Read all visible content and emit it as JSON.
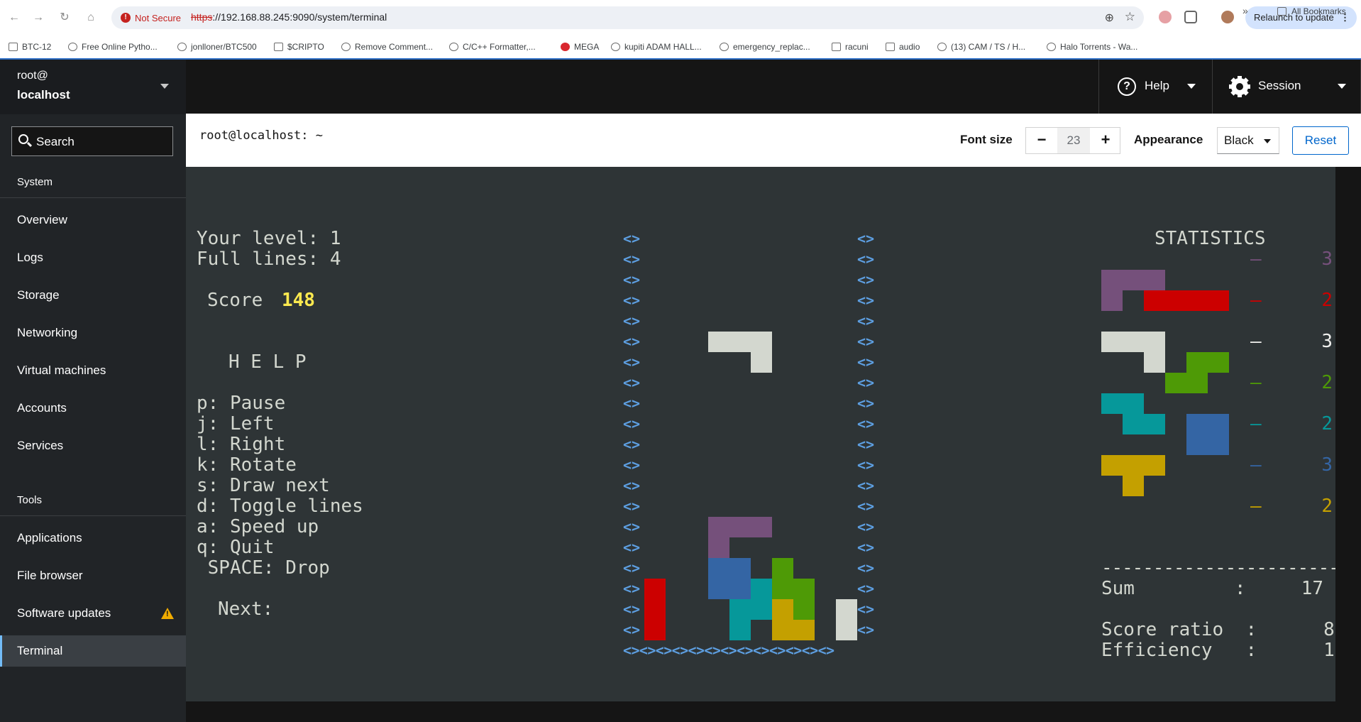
{
  "browser": {
    "security_label": "Not Secure",
    "url_proto": "https",
    "url_rest": "://192.168.88.245:9090/system/terminal",
    "relaunch_label": "Relaunch to update",
    "bookmarks": [
      {
        "label": "BTC-12",
        "icon": "folder-icon"
      },
      {
        "label": "Free Online Pytho...",
        "icon": "site-icon"
      },
      {
        "label": "jonlloner/BTC500",
        "icon": "github-icon"
      },
      {
        "label": "$CRIPTO",
        "icon": "folder-icon"
      },
      {
        "label": "Remove Comment...",
        "icon": "site-icon"
      },
      {
        "label": "C/C++ Formatter,...",
        "icon": "site-icon"
      },
      {
        "label": "MEGA",
        "icon": "mega-icon"
      },
      {
        "label": "kupiti ADAM HALL...",
        "icon": "site-icon"
      },
      {
        "label": "emergency_replac...",
        "icon": "github-icon"
      },
      {
        "label": "racuni",
        "icon": "folder-icon"
      },
      {
        "label": "audio",
        "icon": "folder-icon"
      },
      {
        "label": "(13) CAM / TS / H...",
        "icon": "site-icon"
      },
      {
        "label": "Halo Torrents - Wa...",
        "icon": "site-icon"
      }
    ],
    "all_bookmarks_label": "All Bookmarks",
    "more_label": "»"
  },
  "sidebar": {
    "host_user": "root@",
    "host_name": "localhost",
    "search_label": "Search",
    "system_title": "System",
    "system_items": [
      "Overview",
      "Logs",
      "Storage",
      "Networking",
      "Virtual machines",
      "Accounts",
      "Services"
    ],
    "tools_title": "Tools",
    "tools_items": [
      "Applications",
      "File browser",
      "Software updates",
      "Terminal"
    ],
    "active_item": "Terminal",
    "updates_warning": true
  },
  "masthead": {
    "help_label": "Help",
    "session_label": "Session"
  },
  "toolbar": {
    "title": "root@localhost: ~",
    "font_size_label": "Font size",
    "font_size_value": "23",
    "minus_label": "−",
    "plus_label": "+",
    "appearance_label": "Appearance",
    "appearance_value": "Black",
    "reset_label": "Reset"
  },
  "game": {
    "level_line": "Your level: 1",
    "lines_line": "Full lines: 4",
    "score_label": "Score",
    "score_value": "148",
    "help_title": "H E L P",
    "help_lines": [
      "p: Pause",
      "j: Left",
      "l: Right",
      "k: Rotate",
      "s: Draw next",
      "d: Toggle lines",
      "a: Speed up",
      "q: Quit",
      " SPACE: Drop"
    ],
    "next_label": "Next:",
    "wall_char": "<>",
    "floor_line": "<><><><><><><><><><><><><>",
    "stats_title": "STATISTICS",
    "stats": [
      {
        "piece": "J",
        "color": "#75507b",
        "count": "3"
      },
      {
        "piece": "I",
        "color": "#cc0000",
        "count": "2"
      },
      {
        "piece": "L",
        "color": "#d3d7cf",
        "count": "3"
      },
      {
        "piece": "S",
        "color": "#4e9a06",
        "count": "2"
      },
      {
        "piece": "Z",
        "color": "#06989a",
        "count": "2"
      },
      {
        "piece": "O",
        "color": "#3465a4",
        "count": "3"
      },
      {
        "piece": "T",
        "color": "#c4a000",
        "count": "2"
      }
    ],
    "stat_dash": "–",
    "divider": "-----------------------",
    "sum_line": "Sum         :     17",
    "ratio_line": "Score ratio  :      8",
    "eff_line": "Efficiency   :      1"
  }
}
